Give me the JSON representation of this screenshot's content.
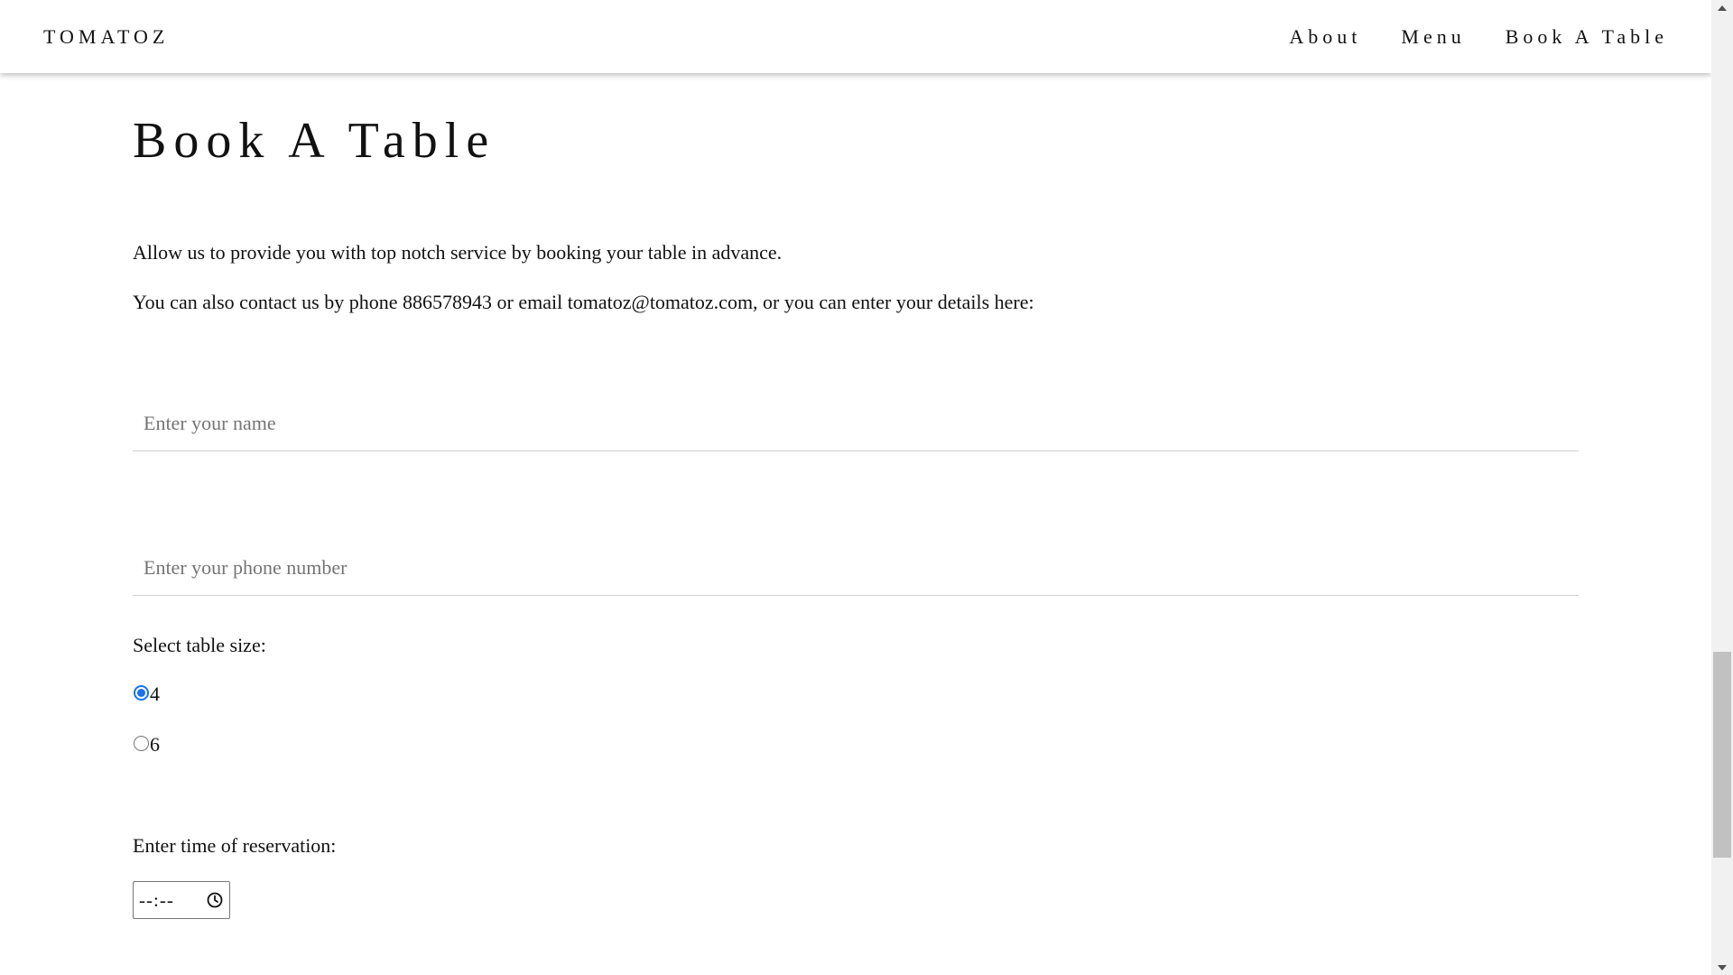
{
  "navbar": {
    "brand": "TOMATOZ",
    "links": [
      {
        "label": "About"
      },
      {
        "label": "Menu"
      },
      {
        "label": "Book A Table"
      }
    ]
  },
  "main": {
    "title": "Book A Table",
    "intro": "Allow us to provide you with top notch service by booking your table in advance.",
    "contact": "You can also contact us by phone 886578943 or email tomatoz@tomatoz.com, or you can enter your details here:",
    "name_field": {
      "placeholder": "Enter your name",
      "value": ""
    },
    "phone_field": {
      "placeholder": "Enter your phone number",
      "value": ""
    },
    "table_size": {
      "label": "Select table size:",
      "options": [
        {
          "label": "4",
          "selected": true
        },
        {
          "label": "6",
          "selected": false
        }
      ]
    },
    "time": {
      "label": "Enter time of reservation:",
      "value": "--:--"
    }
  },
  "icons": {
    "time_picker": "clock-icon",
    "scroll_up": "scroll-up-arrow-icon",
    "scroll_down": "scroll-down-arrow-icon"
  },
  "colors": {
    "accent": "#1a73e8",
    "text": "#111111",
    "placeholder": "#757575",
    "divider": "#cfcfcf",
    "scrollbar_track": "#f1f1f1",
    "scrollbar_thumb": "#c1c1c1"
  }
}
